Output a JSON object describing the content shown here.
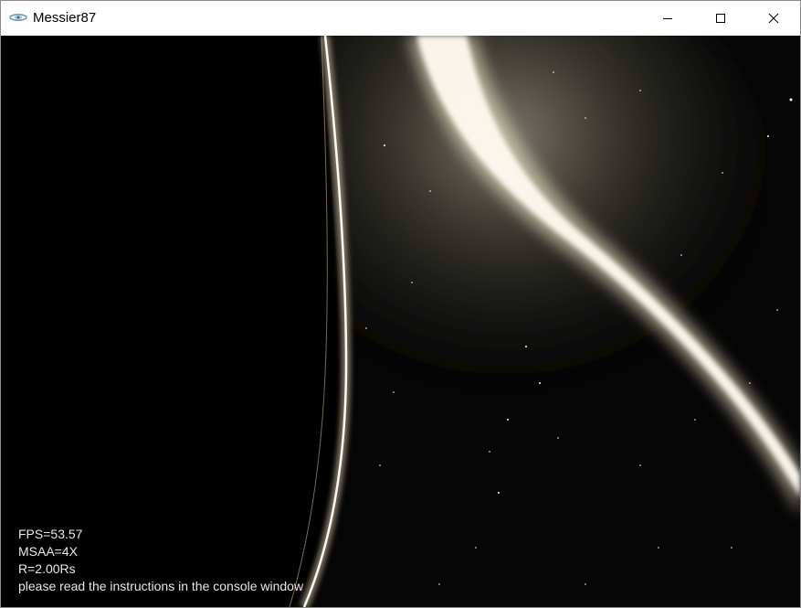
{
  "window": {
    "title": "Messier87",
    "icon": "galaxy-app-icon",
    "controls": {
      "minimize_icon": "minimize-icon",
      "maximize_icon": "maximize-icon",
      "close_icon": "close-icon"
    }
  },
  "hud": {
    "fps": "FPS=53.57",
    "msaa": "MSAA=4X",
    "radius": "R=2.00Rs",
    "instructions": "please read the instructions in the console window"
  },
  "colors": {
    "disk_glow": "#fff6dc",
    "disk_core": "#ffffff",
    "background": "#000000",
    "hud_text": "#e8e8e8"
  }
}
